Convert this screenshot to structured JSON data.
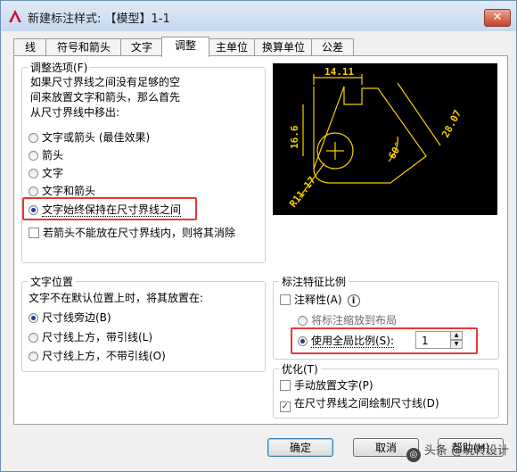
{
  "window": {
    "title": "新建标注样式: 【模型】1-1",
    "close_label": "✕",
    "app_icon": "autocad-logo-icon"
  },
  "tabs": [
    {
      "label": "线",
      "active": false
    },
    {
      "label": "符号和箭头",
      "active": false
    },
    {
      "label": "文字",
      "active": false
    },
    {
      "label": "调整",
      "active": true
    },
    {
      "label": "主单位",
      "active": false
    },
    {
      "label": "换算单位",
      "active": false
    },
    {
      "label": "公差",
      "active": false
    }
  ],
  "fit_options": {
    "legend": "调整选项(F)",
    "description": [
      "如果尺寸界线之间没有足够的空",
      "间来放置文字和箭头，那么首先",
      "从尺寸界线中移出:"
    ],
    "options": [
      {
        "label": "文字或箭头 (最佳效果)",
        "selected": false
      },
      {
        "label": "箭头",
        "selected": false
      },
      {
        "label": "文字",
        "selected": false
      },
      {
        "label": "文字和箭头",
        "selected": false
      },
      {
        "label": "文字始终保持在尺寸界线之间",
        "selected": true
      }
    ],
    "suppress_arrows_label": "若箭头不能放在尺寸界线内，则将其消除",
    "suppress_arrows_checked": false
  },
  "preview": {
    "dim_top": "14.11",
    "dim_left": "16.6",
    "dim_right": "28.07",
    "dim_angle": "60°",
    "dim_radius": "R11.17",
    "line_color": "#f5d000"
  },
  "text_placement": {
    "legend": "文字位置",
    "description": "文字不在默认位置上时，将其放置在:",
    "options": [
      {
        "label": "尺寸线旁边(B)",
        "selected": true
      },
      {
        "label": "尺寸线上方，带引线(L)",
        "selected": false
      },
      {
        "label": "尺寸线上方，不带引线(O)",
        "selected": false
      }
    ]
  },
  "scale_features": {
    "legend": "标注特征比例",
    "annotative_label": "注释性(A)",
    "annotative_checked": false,
    "info_icon": "info-icon",
    "scale_to_layout_label": "将标注缩放到布局",
    "scale_to_layout_selected": false,
    "use_overall_label": "使用全局比例(S):",
    "use_overall_selected": true,
    "overall_value": "1"
  },
  "fine_tuning": {
    "legend": "优化(T)",
    "manual_label": "手动放置文字(P)",
    "manual_checked": false,
    "draw_between_label": "在尺寸界线之间绘制尺寸线(D)",
    "draw_between_checked": true
  },
  "buttons": {
    "ok": "确定",
    "cancel": "取消",
    "help": "帮助(H)"
  },
  "watermark": "头条 @玩转设计",
  "colors": {
    "highlight_box": "#e53935",
    "preview_bg": "#000000"
  }
}
